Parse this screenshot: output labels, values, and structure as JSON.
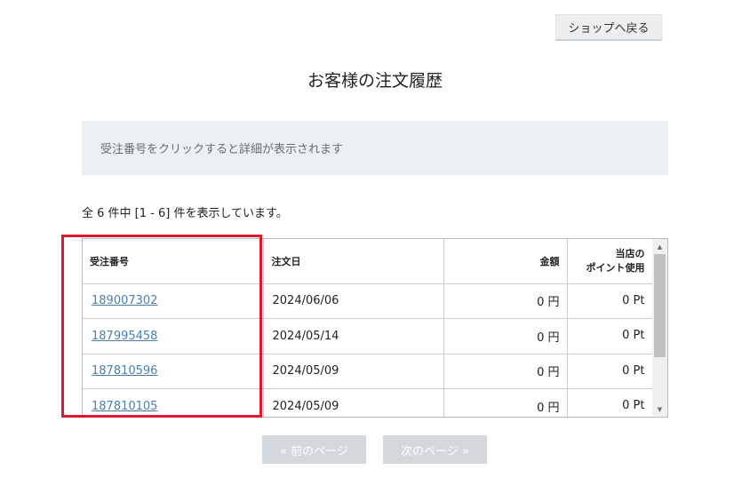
{
  "header": {
    "back_label": "ショップへ戻る"
  },
  "page": {
    "title": "お客様の注文履歴",
    "info": "受注番号をクリックすると詳細が表示されます",
    "count_text": "全 6 件中 [1 - 6] 件を表示しています。"
  },
  "table": {
    "columns": {
      "order_no": "受注番号",
      "order_date": "注文日",
      "amount": "金額",
      "points_line1": "当店の",
      "points_line2": "ポイント使用"
    },
    "rows": [
      {
        "order_no": "189007302",
        "date": "2024/06/06",
        "amount": "0 円",
        "points": "0 Pt"
      },
      {
        "order_no": "187995458",
        "date": "2024/05/14",
        "amount": "0 円",
        "points": "0 Pt"
      },
      {
        "order_no": "187810596",
        "date": "2024/05/09",
        "amount": "0 円",
        "points": "0 Pt"
      },
      {
        "order_no": "187810105",
        "date": "2024/05/09",
        "amount": "0 円",
        "points": "0 Pt"
      }
    ]
  },
  "pager": {
    "prev_label": "« 前のページ",
    "next_label": "次のページ »"
  },
  "icons": {
    "scroll_up": "scroll-up-arrow-icon",
    "scroll_down": "scroll-down-arrow-icon"
  },
  "colors": {
    "link": "#4a7fb0",
    "highlight": "#e0182d",
    "info_bg": "#edf0f2",
    "pager_disabled": "#d3d8dc"
  }
}
